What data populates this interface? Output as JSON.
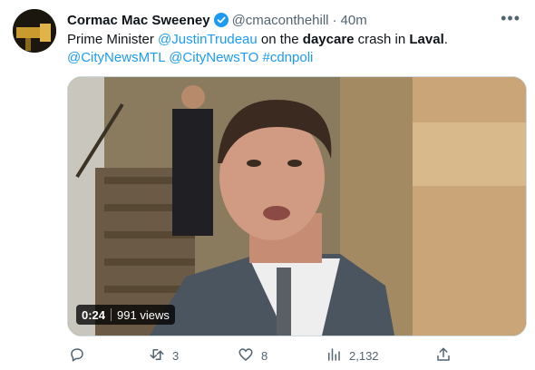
{
  "author": {
    "name": "Cormac Mac Sweeney",
    "handle": "@cmaconthehill",
    "separator": "·",
    "time": "40m"
  },
  "tweet": {
    "t1": "Prime Minister ",
    "mention1": "@JustinTrudeau",
    "t2": " on the ",
    "bold1": "daycare",
    "t3": " crash in ",
    "bold2": "Laval",
    "t4": ".",
    "mention2": "@CityNewsMTL",
    "mention3": "@CityNewsTO",
    "hashtag": "#cdnpoli"
  },
  "video": {
    "duration": "0:24",
    "views": "991 views"
  },
  "actions": {
    "reply_count": "",
    "retweet_count": "3",
    "like_count": "8",
    "view_count": "2,132",
    "share_count": ""
  },
  "icons": {
    "more": "more-horizontal-icon",
    "verified": "verified-badge-icon",
    "reply": "reply-icon",
    "retweet": "retweet-icon",
    "like": "heart-icon",
    "views": "analytics-icon",
    "share": "share-icon"
  },
  "colors": {
    "link": "#1d9bf0",
    "muted": "#536471",
    "text": "#0f1419"
  }
}
